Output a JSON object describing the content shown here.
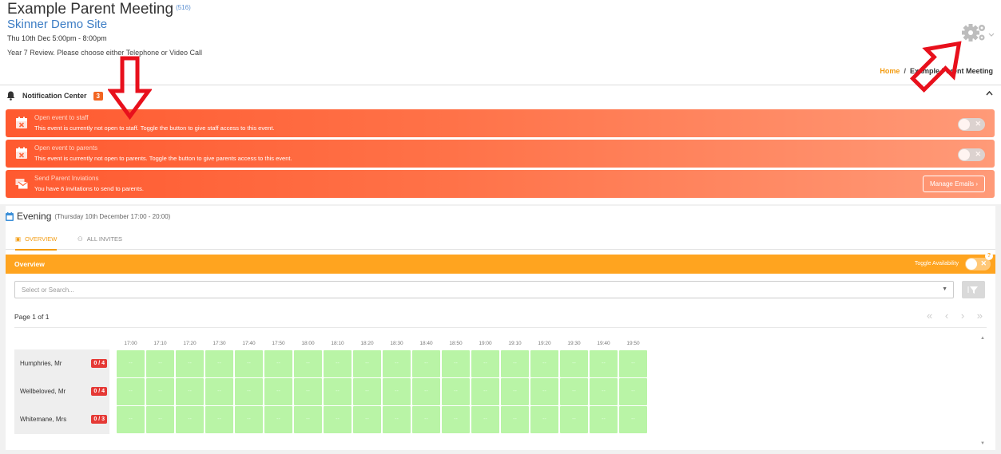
{
  "header": {
    "title": "Example Parent Meeting",
    "event_id": "(516)",
    "site": "Skinner Demo Site",
    "date": "Thu 10th Dec 5:00pm - 8:00pm",
    "description": "Year 7 Review. Please choose either Telephone or Video Call"
  },
  "breadcrumb": {
    "home": "Home",
    "separator": "/",
    "current": "Example Parent Meeting"
  },
  "notification_center": {
    "title": "Notification Center",
    "count": "3",
    "collapse_icon": "chevron-up-icon",
    "items": [
      {
        "icon": "calendar-x-icon",
        "title": "Open event to staff",
        "message": "This event is currently not open to staff. Toggle the button to give staff access to this event.",
        "toggle_x": "✕"
      },
      {
        "icon": "calendar-x-icon",
        "title": "Open event to parents",
        "message": "This event is currently not open to parents. Toggle the button to give parents access to this event.",
        "toggle_x": "✕"
      },
      {
        "icon": "envelopes-icon",
        "title": "Send Parent Inviations",
        "message": "You have 6 invitations to send to parents.",
        "button": "Manage Emails ›"
      }
    ]
  },
  "evening": {
    "title": "Evening",
    "subtitle": "(Thursday 10th December 17:00 - 20:00)"
  },
  "tabs": [
    {
      "label": "OVERVIEW",
      "icon": "calendar-icon",
      "active": true
    },
    {
      "label": "ALL INVITES",
      "icon": "users-icon",
      "active": false
    }
  ],
  "overview": {
    "title": "Overview",
    "toggle_label": "Toggle Availability",
    "toggle_x": "✕",
    "help": "?",
    "search_placeholder": "Select or Search...",
    "page_info": "Page 1 of 1",
    "pager": "« ‹ › »"
  },
  "schedule": {
    "times": [
      "17:00",
      "17:10",
      "17:20",
      "17:30",
      "17:40",
      "17:50",
      "18:00",
      "18:10",
      "18:20",
      "18:30",
      "18:40",
      "18:50",
      "19:00",
      "19:10",
      "19:20",
      "19:30",
      "19:40",
      "19:50"
    ],
    "slot_text": "--",
    "staff": [
      {
        "name": "Humphries, Mr",
        "count": "0 / 4"
      },
      {
        "name": "Wellbeloved, Mr",
        "count": "0 / 4"
      },
      {
        "name": "Whitemane, Mrs",
        "count": "0 / 3"
      }
    ]
  },
  "colors": {
    "accent_orange": "#ffa41f",
    "notification_red": "#ff5a30",
    "slot_green": "#b9f4a6",
    "link_blue": "#3b7cc4",
    "annotation_arrow": "#e8101c"
  }
}
